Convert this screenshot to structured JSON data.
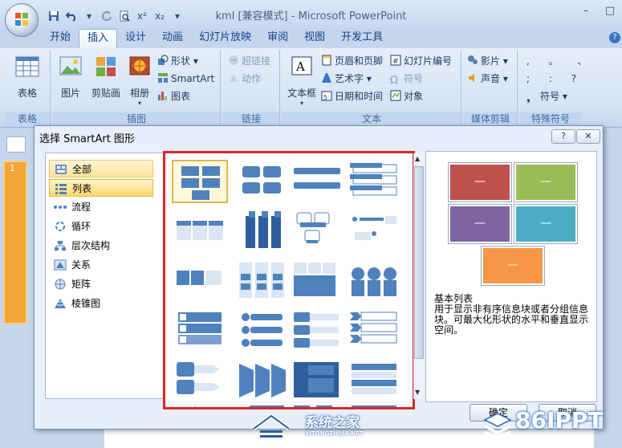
{
  "window": {
    "title": "kml [兼容模式] - Microsoft PowerPoint",
    "minimize": "–",
    "maximize": "□"
  },
  "qat": {
    "redo_arrow": "▾",
    "more": "▾",
    "superscript": "x²",
    "subscript": "x₂"
  },
  "tabs": [
    {
      "label": "开始"
    },
    {
      "label": "插入"
    },
    {
      "label": "设计"
    },
    {
      "label": "动画"
    },
    {
      "label": "幻灯片放映"
    },
    {
      "label": "审阅"
    },
    {
      "label": "视图"
    },
    {
      "label": "开发工具"
    }
  ],
  "ribbon": {
    "table_group": {
      "label": "表格",
      "table_btn": "表格"
    },
    "illustrations": {
      "label": "插图",
      "picture": "图片",
      "clipart": "剪贴画",
      "album": "相册",
      "shapes": "形状",
      "smartart": "SmartArt",
      "chart": "图表"
    },
    "links": {
      "label": "链接",
      "hyperlink": "超链接",
      "action": "动作"
    },
    "text": {
      "label": "文本",
      "textbox": "文本框",
      "header_footer": "页眉和页脚",
      "wordart": "艺术字",
      "datetime": "日期和时间",
      "slide_number": "幻灯片编号",
      "symbol": "符号",
      "object": "对象"
    },
    "media": {
      "label": "媒体剪辑",
      "movie": "影片",
      "sound": "声音"
    },
    "special": {
      "label": "特殊符号",
      "symbol": "符号",
      "row1": ", 。 、",
      "row2": "; : ?"
    }
  },
  "colors": {
    "red": "#c0504d",
    "green": "#9bbb59",
    "purple": "#8064a2",
    "aqua": "#4bacc6",
    "orange": "#f79646",
    "gallery_border": "#d8262a",
    "smartart_blue": "#4f81bd"
  },
  "dialog": {
    "title": "选择 SmartArt 图形",
    "help": "?",
    "close": "✕",
    "categories": [
      {
        "label": "全部",
        "icon": "all-icon"
      },
      {
        "label": "列表",
        "icon": "list-icon"
      },
      {
        "label": "流程",
        "icon": "process-icon"
      },
      {
        "label": "循环",
        "icon": "cycle-icon"
      },
      {
        "label": "层次结构",
        "icon": "hierarchy-icon"
      },
      {
        "label": "关系",
        "icon": "relationship-icon"
      },
      {
        "label": "矩阵",
        "icon": "matrix-icon"
      },
      {
        "label": "棱锥图",
        "icon": "pyramid-icon"
      }
    ],
    "preview": {
      "dash": "—",
      "name": "基本列表",
      "description": "用于显示非有序信息块或者分组信息块。可最大化形状的水平和垂直显示空间。"
    },
    "ok": "确定",
    "cancel": "取消"
  },
  "watermarks": {
    "site_cn": "系统之家",
    "site_url": "XITONGZHIJIA.NET",
    "ppt": "86IPPT"
  }
}
